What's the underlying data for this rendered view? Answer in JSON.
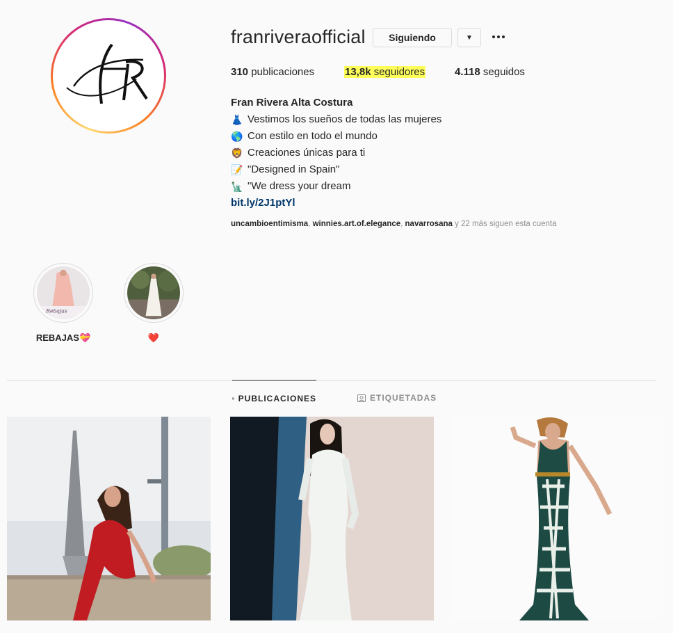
{
  "profile": {
    "username": "franriveraofficial",
    "following_button_label": "Siguiendo",
    "dropdown_glyph": "▼",
    "avatar_monogram": "FR"
  },
  "stats": {
    "posts_count": "310",
    "posts_label": "publicaciones",
    "followers_count": "13,8k",
    "followers_label": "seguidores",
    "following_count": "4.118",
    "following_label": "seguidos"
  },
  "bio": {
    "name": "Fran Rivera Alta Costura",
    "lines": [
      {
        "emoji": "👗",
        "text": "Vestimos los sueños de todas las mujeres"
      },
      {
        "emoji": "🌎",
        "text": "Con estilo en todo el mundo"
      },
      {
        "emoji": "🦁",
        "text": "Creaciones únicas para ti"
      },
      {
        "emoji": "📝",
        "text": "\"Designed in Spain\""
      },
      {
        "emoji": "🗽",
        "text": "\"We dress your dream"
      }
    ],
    "link": "bit.ly/2J1ptYl"
  },
  "followed_by": {
    "accounts": [
      "uncambioentimisma",
      "winnies.art.of.elegance",
      "navarrosana"
    ],
    "separator": ", ",
    "suffix": " y 22 más siguen esta cuenta"
  },
  "highlights": [
    {
      "label": "REBAJAS💝",
      "thumb_text": "Rebajas"
    },
    {
      "label": "❤️"
    }
  ],
  "tabs": {
    "posts_label": "PUBLICACIONES",
    "tagged_label": "ETIQUETADAS"
  },
  "colors": {
    "highlight_yellow": "#ffff5a",
    "link_blue": "#00376b",
    "muted_gray": "#8e8e8e",
    "text_dark": "#262626"
  }
}
